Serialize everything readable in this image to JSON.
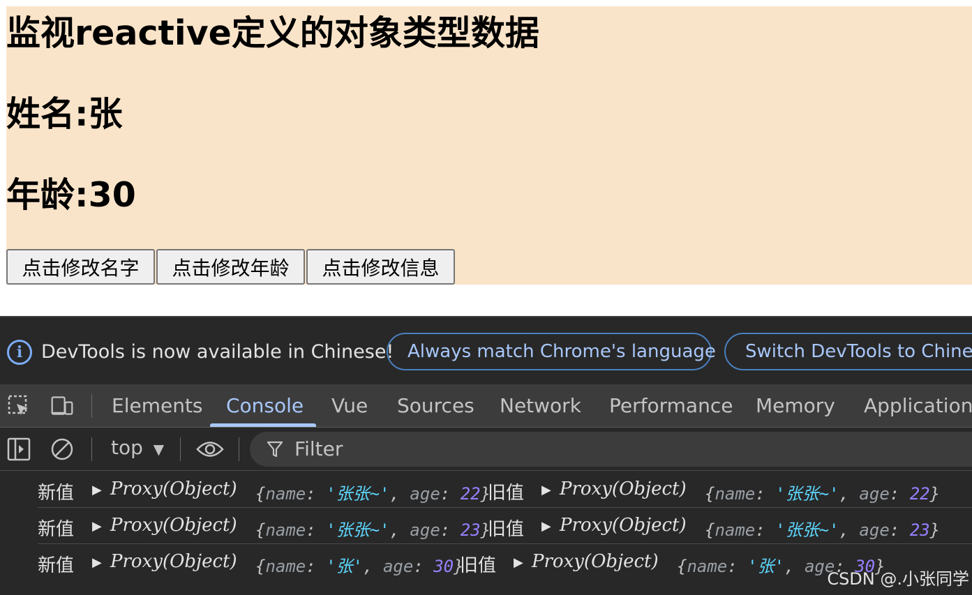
{
  "page": {
    "title": "监视reactive定义的对象类型数据",
    "name_line": "姓名:张",
    "age_line": "年龄:30",
    "buttons": [
      "点击修改名字",
      "点击修改年龄",
      "点击修改信息"
    ],
    "background": "#fae4c9"
  },
  "devtools": {
    "infobar": {
      "icon": "info-icon",
      "message": "DevTools is now available in Chinese!",
      "always_match": "Always match Chrome's language",
      "switch": "Switch DevTools to Chinese"
    },
    "tabs": [
      "Elements",
      "Console",
      "Vue",
      "Sources",
      "Network",
      "Performance",
      "Memory",
      "Application"
    ],
    "active_tab": "Console",
    "toolbar": {
      "context": "top",
      "filter_placeholder": "Filter"
    },
    "console_rows": [
      {
        "new_label": "新值",
        "new_proxy": "Proxy(Object)",
        "new_name": "'张张~'",
        "new_age": "22",
        "old_label": "旧值",
        "old_proxy": "Proxy(Object)",
        "old_name": "'张张~'",
        "old_age": "22"
      },
      {
        "new_label": "新值",
        "new_proxy": "Proxy(Object)",
        "new_name": "'张张~'",
        "new_age": "23",
        "old_label": "旧值",
        "old_proxy": "Proxy(Object)",
        "old_name": "'张张~'",
        "old_age": "23"
      },
      {
        "new_label": "新值",
        "new_proxy": "Proxy(Object)",
        "new_name": "'张'",
        "new_age": "30",
        "old_label": "旧值",
        "old_proxy": "Proxy(Object)",
        "old_name": "'张'",
        "old_age": "30"
      }
    ],
    "keys": {
      "name": "name",
      "age": "age"
    },
    "colors": {
      "accent": "#a8c7fa",
      "string": "#5cd5fb",
      "number": "#9980ff"
    }
  },
  "watermark": "CSDN @.小张同学"
}
